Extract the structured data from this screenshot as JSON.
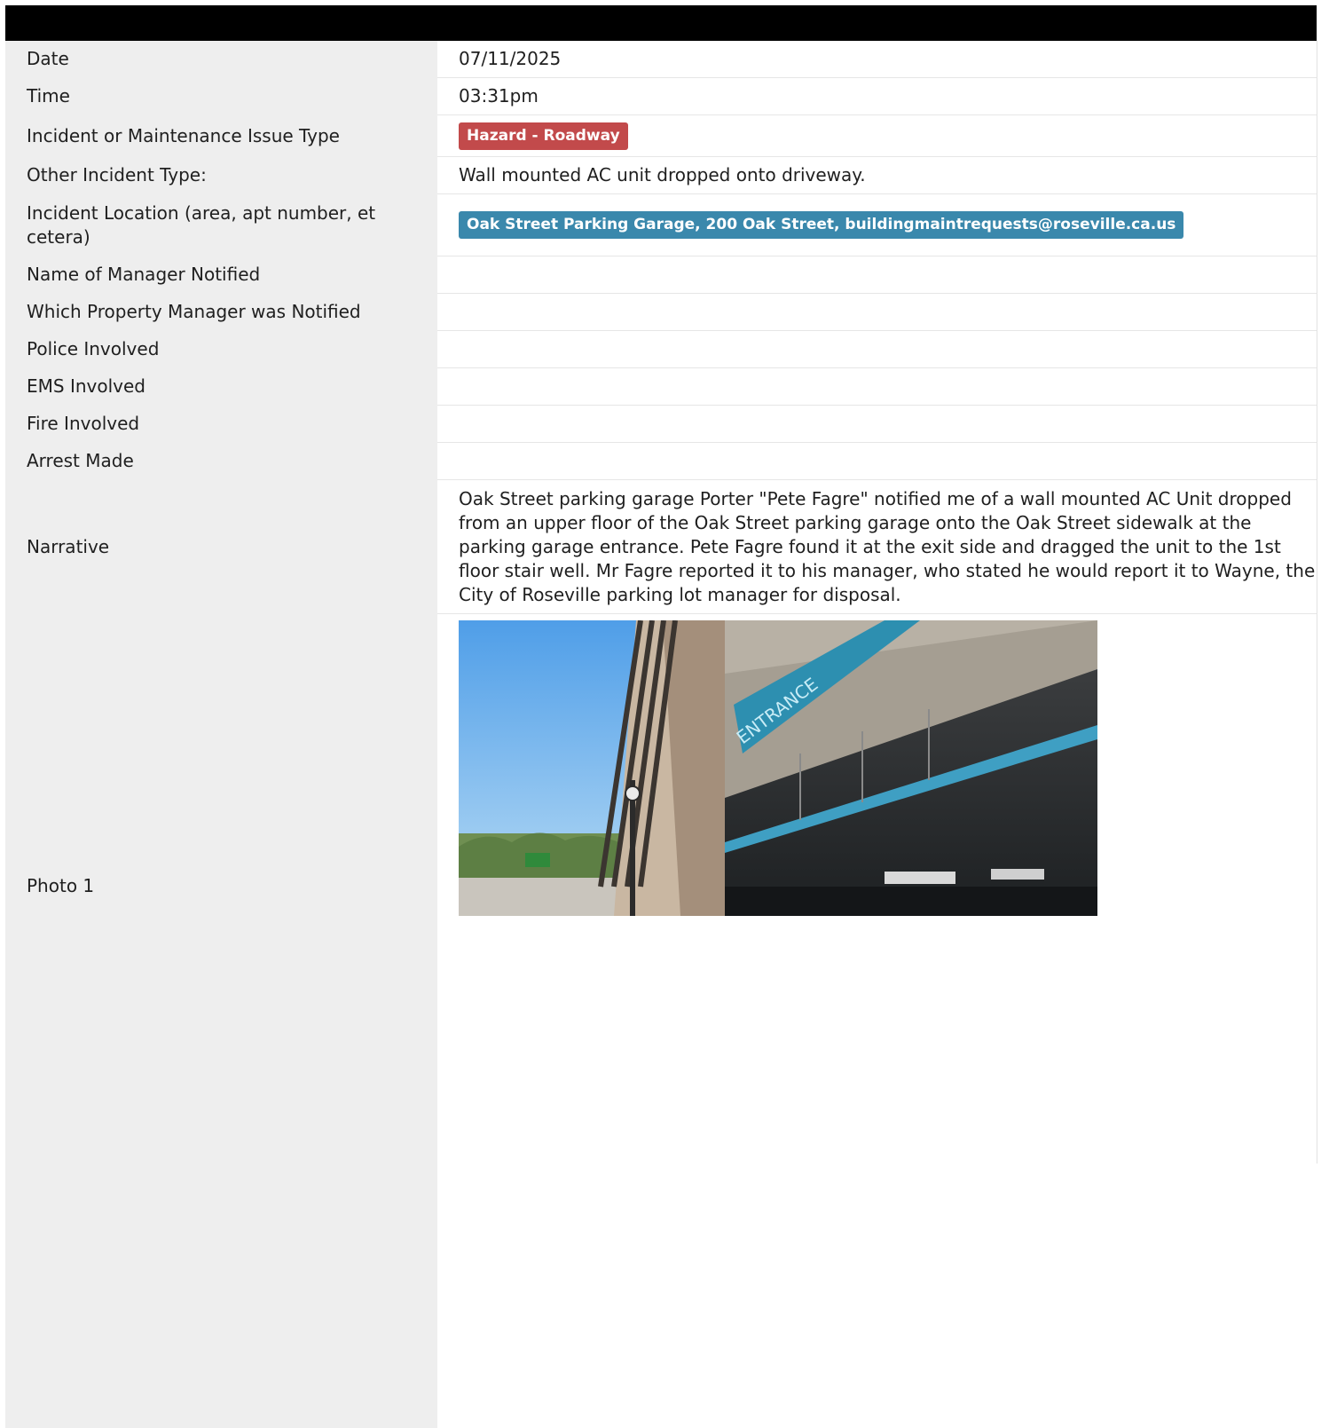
{
  "fields": {
    "date": {
      "label": "Date",
      "value": "07/11/2025"
    },
    "time": {
      "label": "Time",
      "value": "03:31pm"
    },
    "issue_type": {
      "label": "Incident or Maintenance Issue Type",
      "value": "Hazard - Roadway",
      "badge_color": "#c24a4b"
    },
    "other_type": {
      "label": "Other Incident Type:",
      "value": "Wall mounted AC unit dropped onto driveway."
    },
    "location": {
      "label": "Incident Location (area, apt number, et cetera)",
      "value": "Oak Street Parking Garage, 200 Oak Street, buildingmaintrequests@roseville.ca.us",
      "badge_color": "#3a88ac"
    },
    "manager_name": {
      "label": "Name of Manager Notified",
      "value": ""
    },
    "property_manager": {
      "label": "Which Property Manager was Notified",
      "value": ""
    },
    "police": {
      "label": "Police Involved",
      "value": ""
    },
    "ems": {
      "label": "EMS Involved",
      "value": ""
    },
    "fire": {
      "label": "Fire Involved",
      "value": ""
    },
    "arrest": {
      "label": "Arrest Made",
      "value": ""
    },
    "narrative": {
      "label": "Narrative",
      "value": "Oak Street parking garage Porter \"Pete Fagre\" notified me of a wall mounted AC Unit dropped from an upper floor of the Oak Street parking garage onto the Oak Street sidewalk at the parking garage entrance. Pete Fagre found it at the exit side and dragged the unit to the 1st floor stair well. Mr Fagre reported it to his manager, who stated he would report it to Wayne, the City of Roseville parking lot manager for disposal."
    },
    "photo1": {
      "label": "Photo 1"
    }
  },
  "colors": {
    "header": "#000000",
    "label_bg": "#eeeeee"
  }
}
